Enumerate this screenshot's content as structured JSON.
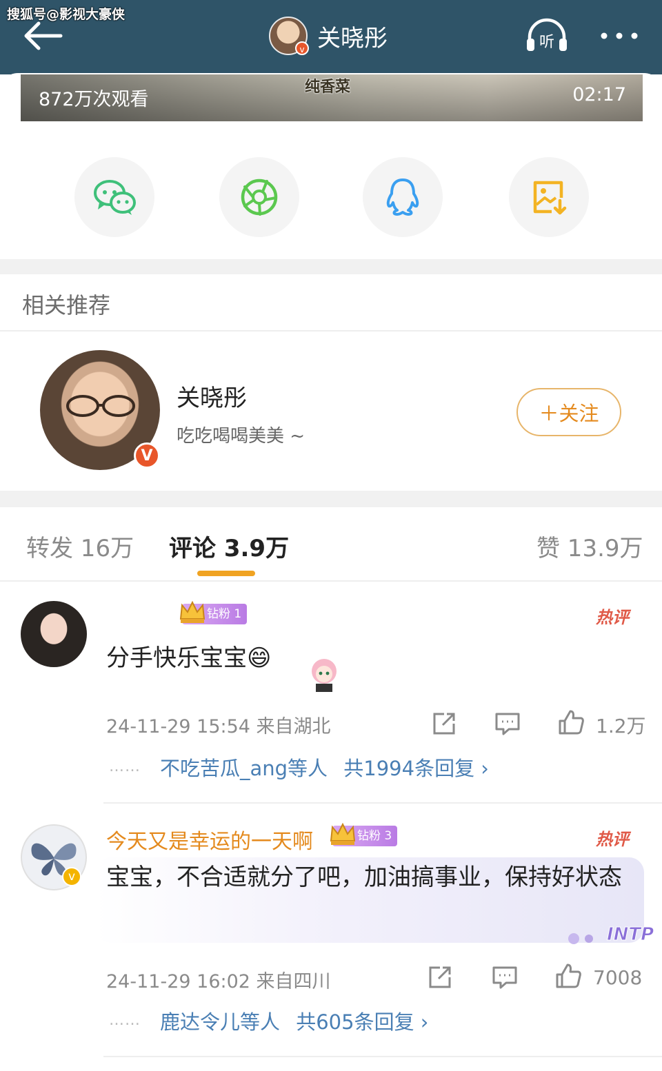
{
  "watermark": "搜狐号@影视大豪侠",
  "header": {
    "title": "关晓彤",
    "back_icon": "arrow-left-icon",
    "listen_label": "听",
    "more_icon": "more-dots-icon"
  },
  "video": {
    "views": "872万次观看",
    "caption": "纯香菜",
    "duration": "02:17"
  },
  "share": {
    "items": [
      {
        "icon": "wechat-icon",
        "color": "#3fc07a"
      },
      {
        "icon": "moments-icon",
        "color": "#5bc84f"
      },
      {
        "icon": "qq-icon",
        "color": "#3a9ff0"
      },
      {
        "icon": "save-image-icon",
        "color": "#f3b323"
      }
    ]
  },
  "recommend": {
    "section_title": "相关推荐",
    "name": "关晓彤",
    "desc": "吃吃喝喝美美 ~",
    "verified_mark": "V",
    "follow_label": "＋关注"
  },
  "tabs": {
    "repost": "转发 16万",
    "comments": "评论 3.9万",
    "likes": "赞 13.9万"
  },
  "comments": [
    {
      "name": "",
      "badge": "钻粉 1",
      "hot": "热评",
      "text": "分手快乐宝宝😄",
      "time_loc": "24-11-29 15:54  来自湖北",
      "likes": "1.2万",
      "reply_dots": "……",
      "replies_by": "不吃苦瓜_ang等人",
      "replies_total": "共1994条回复 ›"
    },
    {
      "name": "今天又是幸运的一天啊",
      "badge": "钻粉 3",
      "hot": "热评",
      "text": "宝宝，不合适就分了吧，加油搞事业，保持好状态",
      "time_loc": "24-11-29 16:02  来自四川",
      "likes": "7008",
      "reply_dots": "……",
      "replies_by": "鹿达令儿等人",
      "replies_total": "共605条回复 ›",
      "sticker_text": "INTP"
    }
  ],
  "colors": {
    "header_bg": "#2f5468",
    "accent": "#f0a322",
    "link": "#4a7fb4",
    "hot": "#e05a48"
  }
}
